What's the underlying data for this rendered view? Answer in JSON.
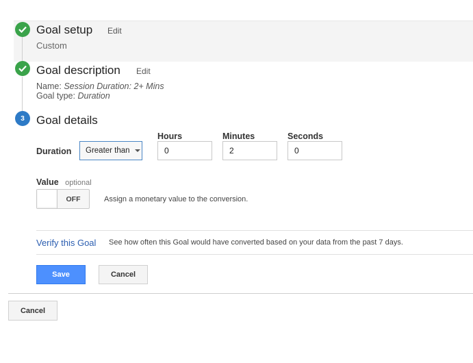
{
  "steps": [
    {
      "title": "Goal setup",
      "edit": "Edit",
      "subtitle": "Custom",
      "status": "complete"
    },
    {
      "title": "Goal description",
      "edit": "Edit",
      "name_label": "Name:",
      "name_value": "Session Duration: 2+ Mins",
      "type_label": "Goal type:",
      "type_value": "Duration",
      "status": "complete"
    },
    {
      "number": "3",
      "title": "Goal details",
      "status": "active"
    }
  ],
  "details": {
    "duration_label": "Duration",
    "condition": "Greater than",
    "hours_label": "Hours",
    "hours_value": "0",
    "minutes_label": "Minutes",
    "minutes_value": "2",
    "seconds_label": "Seconds",
    "seconds_value": "0",
    "value_label": "Value",
    "value_optional": "optional",
    "toggle_state": "OFF",
    "value_help": "Assign a monetary value to the conversion.",
    "verify_link": "Verify this Goal",
    "verify_help": "See how often this Goal would have converted based on your data from the past 7 days.",
    "save_label": "Save",
    "cancel_label": "Cancel"
  },
  "footer": {
    "cancel_label": "Cancel"
  },
  "colors": {
    "complete": "#3aa34a",
    "active": "#2d7ac6",
    "primary": "#4d90fe",
    "link": "#2a5db0"
  },
  "icons": {
    "complete": "check-icon",
    "dropdown": "caret-down-icon"
  }
}
